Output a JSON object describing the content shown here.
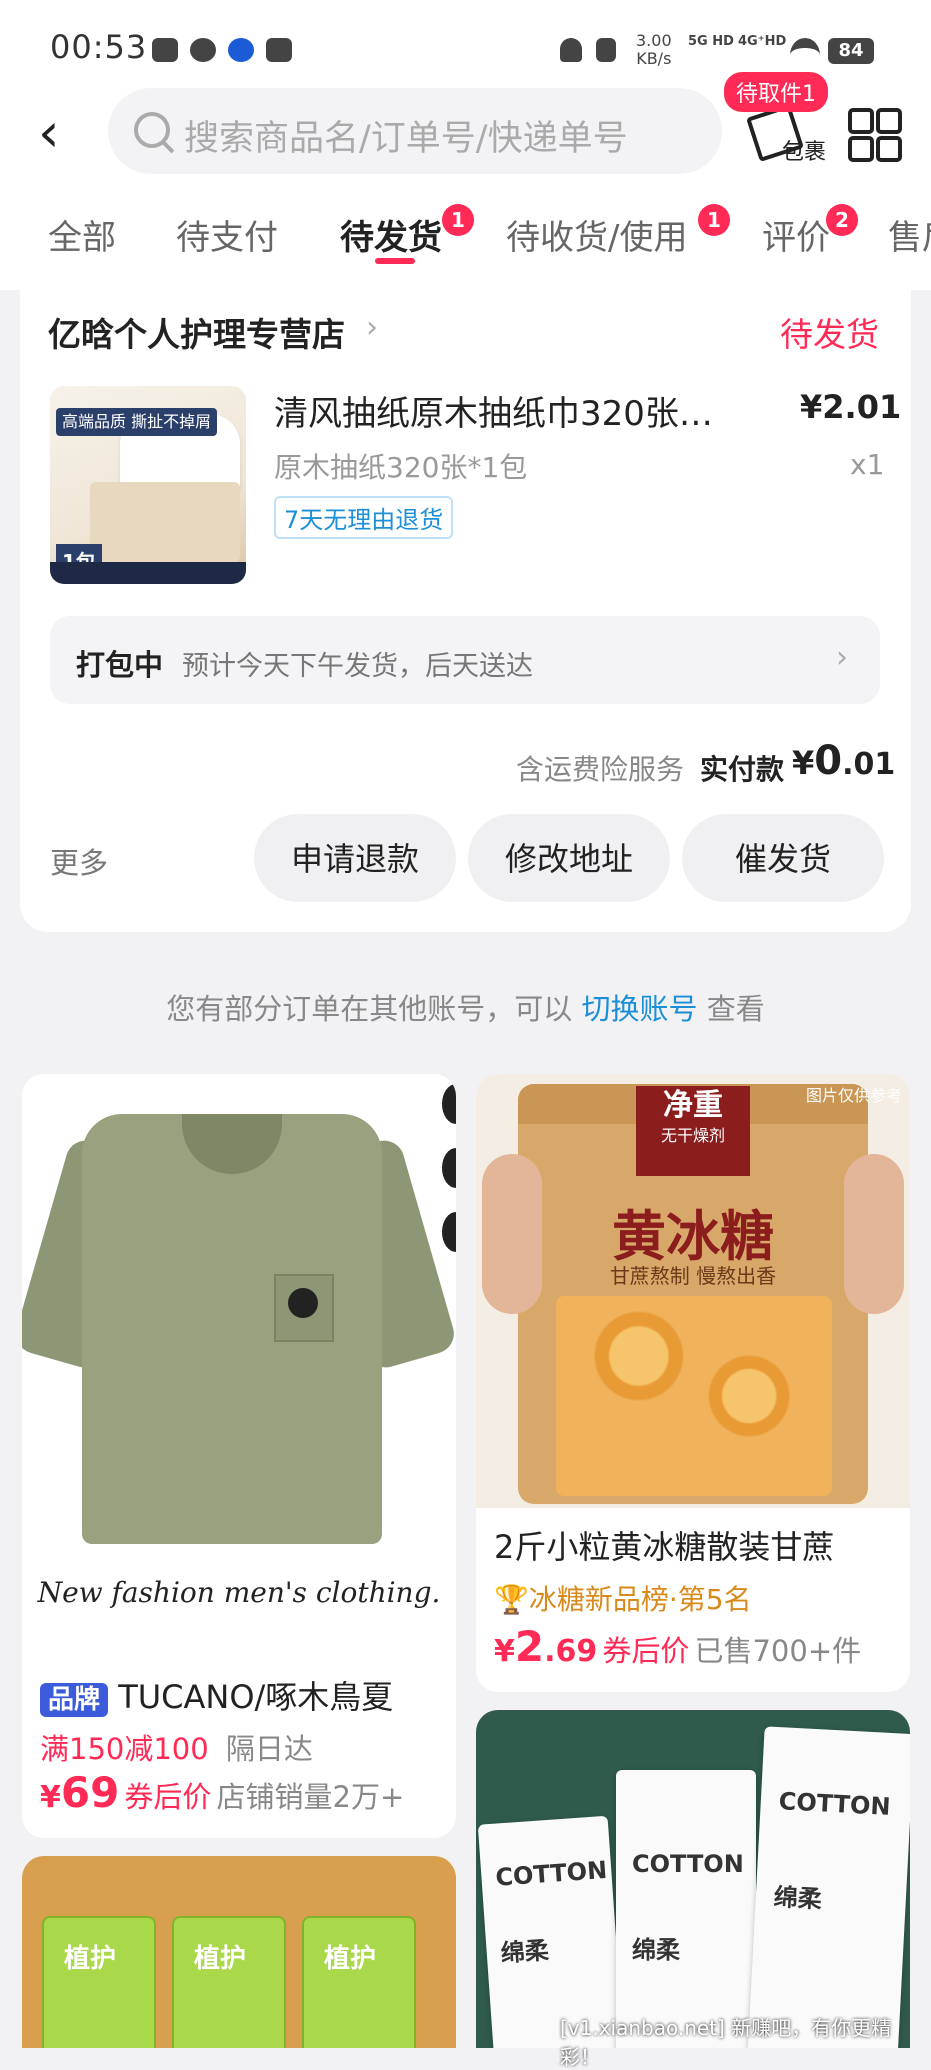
{
  "status_bar": {
    "time": "00:53",
    "speed_value": "3.00",
    "speed_unit": "KB/s",
    "net1": "5G HD",
    "net2": "4G⁺HD",
    "battery": "84"
  },
  "header": {
    "search_placeholder": "搜索商品名/订单号/快递单号",
    "package_badge": "待取件1",
    "package_label": "包裹"
  },
  "tabs": [
    {
      "label": "全部",
      "active": false,
      "badge": ""
    },
    {
      "label": "待支付",
      "active": false,
      "badge": ""
    },
    {
      "label": "待发货",
      "active": true,
      "badge": "1"
    },
    {
      "label": "待收货/使用",
      "active": false,
      "badge": "1"
    },
    {
      "label": "评价",
      "active": false,
      "badge": "2"
    },
    {
      "label": "售后",
      "active": false,
      "badge": ""
    }
  ],
  "order": {
    "store_name": "亿晗个人护理专营店",
    "status": "待发货",
    "thumb_tag": "高端品质 撕扯不掉屑",
    "thumb_num": "1包",
    "product_name": "清风抽纸原木抽纸巾320张…",
    "price": "¥2.01",
    "spec": "原木抽纸320张*1包",
    "qty": "x1",
    "tag": "7天无理由退货",
    "ship_label": "打包中",
    "ship_text": "预计今天下午发货，后天送达",
    "insurance": "含运费险服务",
    "paid_label": "实付款",
    "paid_currency": "¥",
    "paid_int": "0",
    "paid_dec": ".01",
    "more": "更多",
    "buttons": [
      "申请退款",
      "修改地址",
      "催发货"
    ]
  },
  "notice": {
    "prefix": "您有部分订单在其他账号，可以",
    "link": "切换账号",
    "suffix": "查看"
  },
  "feed": [
    {
      "image_caption": "New fashion men's clothing.",
      "brand_badge": "品牌",
      "title": "TUCANO/啄木鳥夏",
      "promo": "满150减100",
      "promo_extra": "隔日达",
      "currency": "¥",
      "price": "69",
      "price_label": "券后价",
      "sales": "店铺销量2万+"
    },
    {
      "image_label_top": "净重",
      "image_label_sub": "无干燥剂",
      "image_title": "黄冰糖",
      "image_sub": "甘蔗熬制 慢熬出香",
      "image_ref": "图片仅供参考",
      "title": "2斤小粒黄冰糖散装甘蔗",
      "rank": "冰糖新品榜·第5名",
      "currency": "¥",
      "price": "2",
      "price_dec": ".69",
      "price_label": "券后价",
      "sales": "已售700+件"
    },
    {
      "box_label": "COTTON",
      "box_label2": "绵柔"
    },
    {
      "box_text": "植护"
    }
  ],
  "watermark": "[v1.xianbao.net] 新赚吧，有你更精彩！",
  "colors": {
    "accent": "#ff2a55",
    "link": "#1c8fd6",
    "background": "#f2f2f5"
  }
}
